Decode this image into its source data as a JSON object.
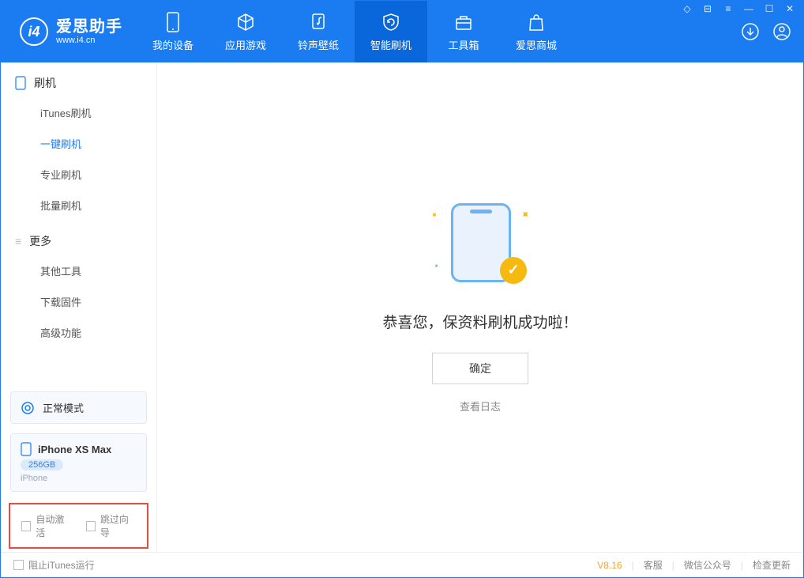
{
  "app": {
    "title": "爱思助手",
    "subtitle": "www.i4.cn"
  },
  "tabs": {
    "device": "我的设备",
    "apps": "应用游戏",
    "ring": "铃声壁纸",
    "flash": "智能刷机",
    "toolbox": "工具箱",
    "store": "爱思商城"
  },
  "sidebar": {
    "group_flash": "刷机",
    "itunes_flash": "iTunes刷机",
    "one_key": "一键刷机",
    "pro_flash": "专业刷机",
    "batch_flash": "批量刷机",
    "group_more": "更多",
    "other_tools": "其他工具",
    "download_fw": "下载固件",
    "advanced": "高级功能"
  },
  "mode": {
    "label": "正常模式"
  },
  "device": {
    "name": "iPhone XS Max",
    "storage": "256GB",
    "type": "iPhone"
  },
  "options": {
    "auto_activate": "自动激活",
    "skip_guide": "跳过向导"
  },
  "main": {
    "success": "恭喜您，保资料刷机成功啦！",
    "ok": "确定",
    "view_log": "查看日志"
  },
  "footer": {
    "block_itunes": "阻止iTunes运行",
    "version": "V8.16",
    "support": "客服",
    "wechat": "微信公众号",
    "update": "检查更新"
  }
}
